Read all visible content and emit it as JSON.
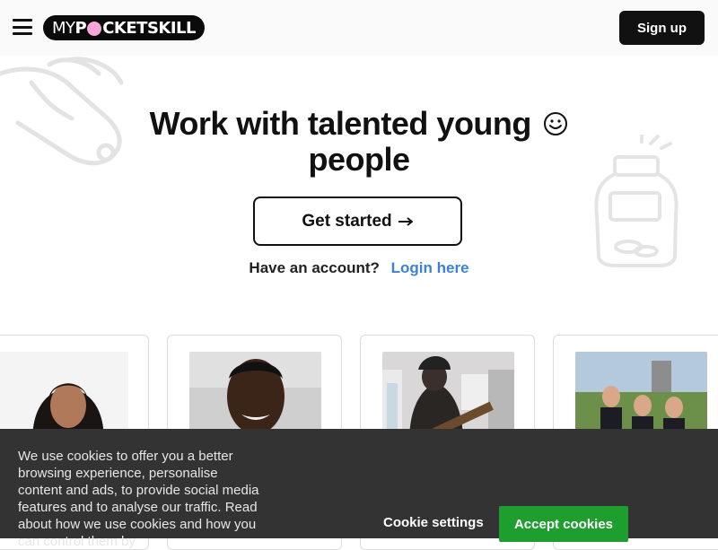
{
  "header": {
    "logo_my": "MY",
    "logo_rest": "CKETSKILL",
    "signup_label": "Sign up"
  },
  "hero": {
    "title_line1": "Work with talented young",
    "title_line2": "people",
    "cta_label": "Get started",
    "login_question": "Have an account?",
    "login_link": "Login here"
  },
  "cookie_banner": {
    "text": "We use cookies to offer you a better browsing experience, personalise content and ads, to provide social media features and to analyse our traffic. Read about how we use cookies and how you can control them by",
    "settings_label": "Cookie settings",
    "accept_label": "Accept cookies"
  },
  "colors": {
    "brand_dark": "#111111",
    "link_blue": "#3b82d6",
    "accept_green": "#1e9e2f",
    "banner_bg": "#333333"
  }
}
